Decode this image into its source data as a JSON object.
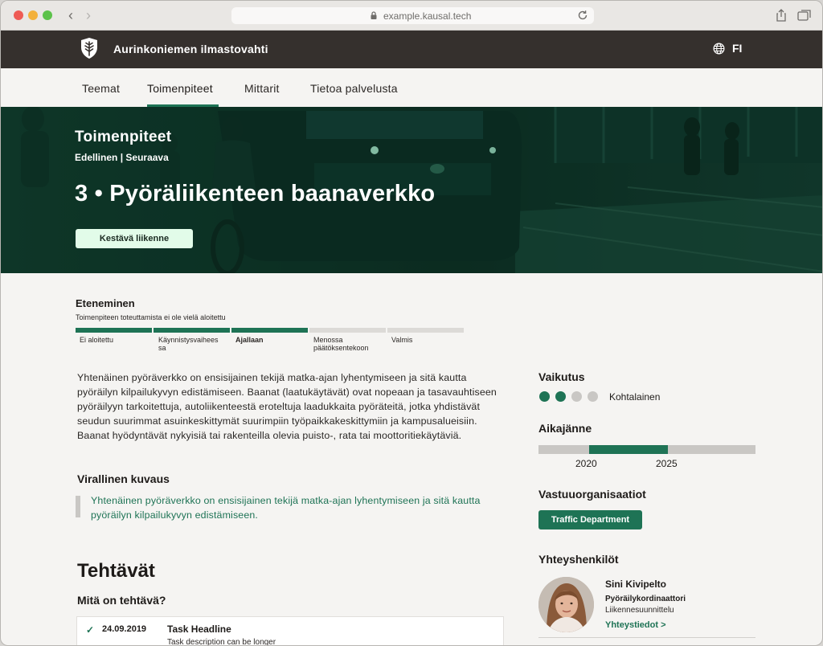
{
  "browser": {
    "url": "example.kausal.tech"
  },
  "header": {
    "site_name": "Aurinkoniemen ilmastovahti",
    "language": "FI"
  },
  "nav": {
    "items": [
      {
        "label": "Teemat"
      },
      {
        "label": "Toimenpiteet"
      },
      {
        "label": "Mittarit"
      },
      {
        "label": "Tietoa palvelusta"
      }
    ],
    "active": "Toimenpiteet"
  },
  "hero": {
    "section": "Toimenpiteet",
    "prev_link": "Edellinen",
    "separator": "|",
    "next_link": "Seuraava",
    "title": "3 • Pyöräliikenteen baanaverkko",
    "category": "Kestävä liikenne"
  },
  "progress": {
    "title": "Eteneminen",
    "subtitle": "Toimenpiteen toteuttamista ei ole vielä aloitettu",
    "steps": [
      {
        "label": "Ei aloitettu",
        "done": true,
        "current": false
      },
      {
        "label": "Käynnistysvaiheessa",
        "done": true,
        "current": false
      },
      {
        "label": "Ajallaan",
        "done": true,
        "current": true
      },
      {
        "label": "Menossa päätöksentekoon",
        "done": false,
        "current": false
      },
      {
        "label": "Valmis",
        "done": false,
        "current": false
      }
    ]
  },
  "description": "Yhtenäinen pyöräverkko on ensisijainen tekijä matka-ajan lyhentymiseen ja sitä kautta pyöräilyn kilpailukyvyn edistämiseen. Baanat (laatukäytävät) ovat nopeaan ja tasavauhtiseen pyöräilyyn tarkoitettuja, autoliikenteestä eroteltuja laadukkaita pyöräteitä, jotka yhdistävät seudun suurimmat asuinkeskittymät suurimpiin työpaikkakeskittymiin ja kampusalueisiin. Baanat hyödyntävät nykyisiä tai rakenteilla olevia puisto-, rata tai moottoritiekäytäviä.",
  "official": {
    "heading": "Virallinen kuvaus",
    "text": "Yhtenäinen pyöräverkko on ensisijainen tekijä matka-ajan lyhentymiseen ja sitä kautta pyöräilyn kilpailukyvyn edistämiseen."
  },
  "tasks": {
    "heading": "Tehtävät",
    "subheading": "Mitä on tehtävä?",
    "items": [
      {
        "date": "24.09.2019",
        "headline": "Task Headline",
        "description": "Task description can be longer"
      }
    ]
  },
  "sidebar": {
    "impact": {
      "heading": "Vaikutus",
      "level": 2,
      "max": 4,
      "label": "Kohtalainen"
    },
    "timeline": {
      "heading": "Aikajänne",
      "start_year": "2020",
      "end_year": "2025"
    },
    "orgs": {
      "heading": "Vastuuorganisaatiot",
      "items": [
        "Traffic Department"
      ]
    },
    "contacts": {
      "heading": "Yhteyshenkilöt",
      "items": [
        {
          "name": "Sini Kivipelto",
          "role": "Pyöräilykordinaattori",
          "department": "Liikennesuunnittelu",
          "link": "Yhteystiedot >"
        }
      ]
    }
  },
  "colors": {
    "brand": "#1e7355",
    "header_bg": "#35302d",
    "page_bg": "#f5f4f2",
    "badge_bg": "#e2fce9",
    "inactive": "#c9c7c4"
  },
  "icons": {
    "logo": "leaf-shield-icon",
    "language": "globe-icon",
    "lock": "lock-icon",
    "reload": "reload-icon",
    "task_done": "check-icon"
  }
}
